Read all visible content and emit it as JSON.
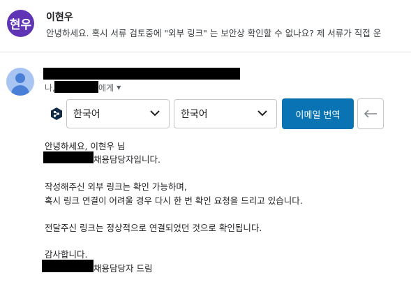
{
  "thread": {
    "avatar_text": "현우",
    "sender": "이현우",
    "snippet": "안녕하세요. 혹시 서류 검토중에 \"외부 링크\" 는 보안상 확인할 수 없나요? 제 서류가 직접 운"
  },
  "message": {
    "to_prefix": "나,",
    "to_suffix": "에게",
    "caret": "▼"
  },
  "translate": {
    "source_lang": "한국어",
    "target_lang": "한국어",
    "button_label": "이메일 번역"
  },
  "body": {
    "greeting": "안녕하세요, 이현우 님",
    "intro_suffix": "채용담당자입니다.",
    "para1_line1": "작성해주신 외부 링크는 확인 가능하며,",
    "para1_line2": "혹시 링크 연결이 어려울 경우 다시 한 번 확인 요청을 드리고 있습니다.",
    "para2": "전달주신 링크는 정상적으로 연결되었던 것으로 확인됩니다.",
    "thanks": "감사합니다.",
    "sign_suffix": "채용담당자 드림"
  },
  "colors": {
    "avatar_purple": "#5f34b5",
    "translate_button": "#0a73b3"
  }
}
